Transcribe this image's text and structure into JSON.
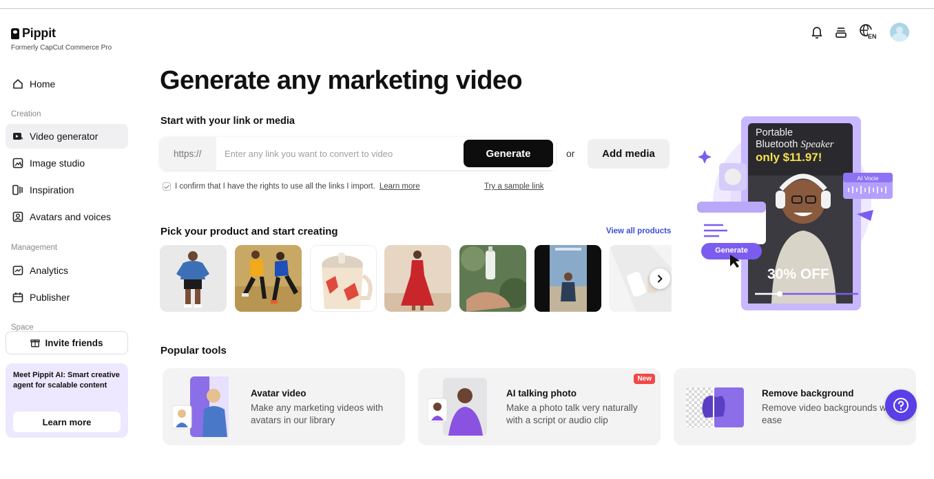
{
  "brand": {
    "name": "Pippit",
    "subtitle": "Formerly CapCut Commerce Pro"
  },
  "sidebar": {
    "home": "Home",
    "creation_label": "Creation",
    "creation_items": [
      {
        "label": "Video generator",
        "icon": "video-generator-icon",
        "active": true
      },
      {
        "label": "Image studio",
        "icon": "image-studio-icon"
      },
      {
        "label": "Inspiration",
        "icon": "inspiration-icon"
      },
      {
        "label": "Avatars and voices",
        "icon": "avatar-icon"
      }
    ],
    "management_label": "Management",
    "management_items": [
      {
        "label": "Analytics",
        "icon": "analytics-icon"
      },
      {
        "label": "Publisher",
        "icon": "calendar-icon"
      }
    ],
    "space_label": "Space",
    "invite_label": "Invite friends",
    "promo": {
      "text": "Meet Pippit AI: Smart creative agent for scalable content",
      "button": "Learn more"
    }
  },
  "topbar": {
    "language": "EN",
    "icons": [
      "bell-icon",
      "stack-icon",
      "globe-icon",
      "avatar"
    ]
  },
  "main": {
    "title": "Generate any marketing video",
    "link_section_title": "Start with your link or media",
    "link_prefix": "https://",
    "link_placeholder": "Enter any link you want to convert to video",
    "generate_label": "Generate",
    "or_label": "or",
    "add_media_label": "Add media",
    "confirm_text": "I confirm that I have the rights to use all the links I import.",
    "learn_more_link": "Learn more",
    "sample_link": "Try a sample link",
    "products_title": "Pick your product and start creating",
    "view_all": "View all products",
    "popular_title": "Popular tools",
    "tools": [
      {
        "name": "Avatar video",
        "desc": "Make any marketing videos with avatars in our library",
        "badge": ""
      },
      {
        "name": "AI talking photo",
        "desc": "Make a photo talk very naturally with a script or audio clip",
        "badge": "New"
      },
      {
        "name": "Remove background",
        "desc": "Remove video backgrounds with ease",
        "badge": ""
      }
    ]
  },
  "hero_art": {
    "product_line1": "Portable",
    "product_line2": "Bluetooth",
    "product_line2_italic": "Speaker",
    "price": "only $11.97!",
    "discount": "30% OFF",
    "generate_chip": "Generate",
    "voice_chip": "AI Vocie"
  },
  "colors": {
    "accent_purple": "#7b5cf0",
    "help_button": "#5b3fe6",
    "link_blue": "#3b4fd8",
    "price_yellow": "#f4e04d",
    "new_badge": "#f04848"
  }
}
